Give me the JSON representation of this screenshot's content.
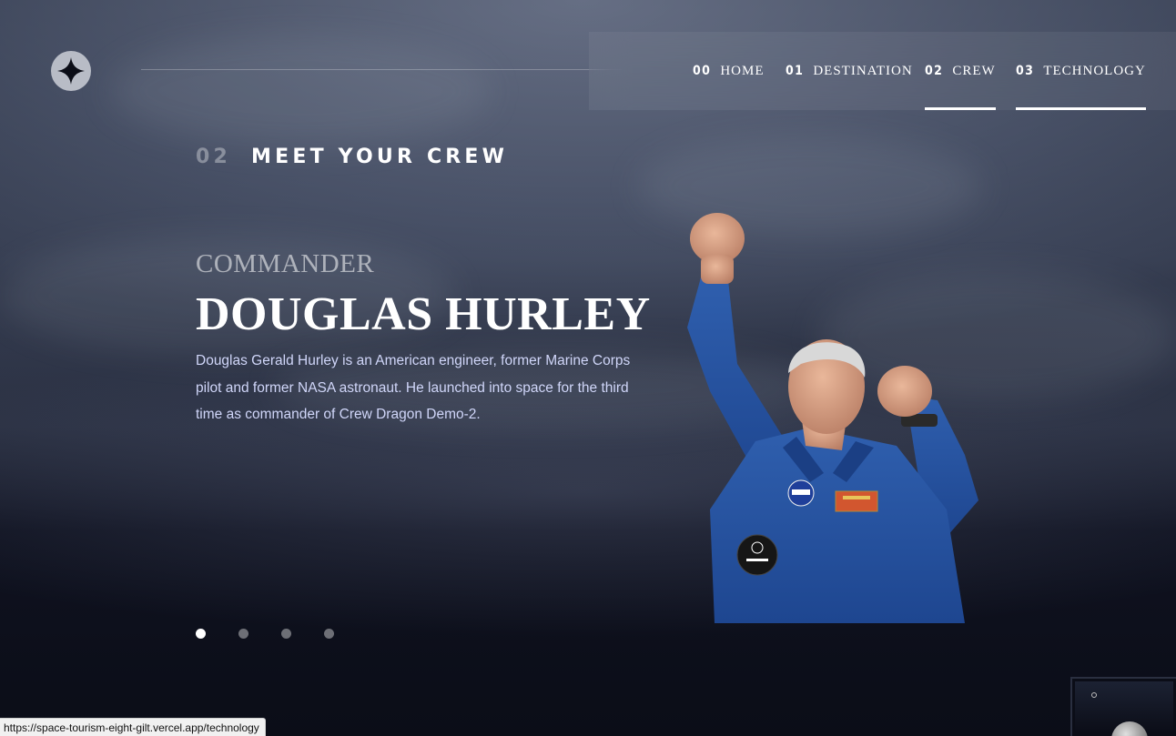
{
  "nav": {
    "items": [
      {
        "num": "00",
        "label": "HOME"
      },
      {
        "num": "01",
        "label": "DESTINATION"
      },
      {
        "num": "02",
        "label": "CREW"
      },
      {
        "num": "03",
        "label": "TECHNOLOGY"
      }
    ],
    "active_index": 2,
    "hover_index": 3
  },
  "page_heading": {
    "num": "02",
    "title": "MEET YOUR CREW"
  },
  "crew": {
    "role": "COMMANDER",
    "name": "DOUGLAS HURLEY",
    "bio": "Douglas Gerald Hurley is an American engineer, former Marine Corps pilot and former NASA astronaut. He launched into space for the third time as commander of Crew Dragon Demo-2.",
    "dots_count": 4,
    "active_dot": 0
  },
  "status_url": "https://space-tourism-eight-gilt.vercel.app/technology",
  "colors": {
    "background": "#0b0d17",
    "text": "#ffffff",
    "body_text": "#d0d6f9"
  }
}
